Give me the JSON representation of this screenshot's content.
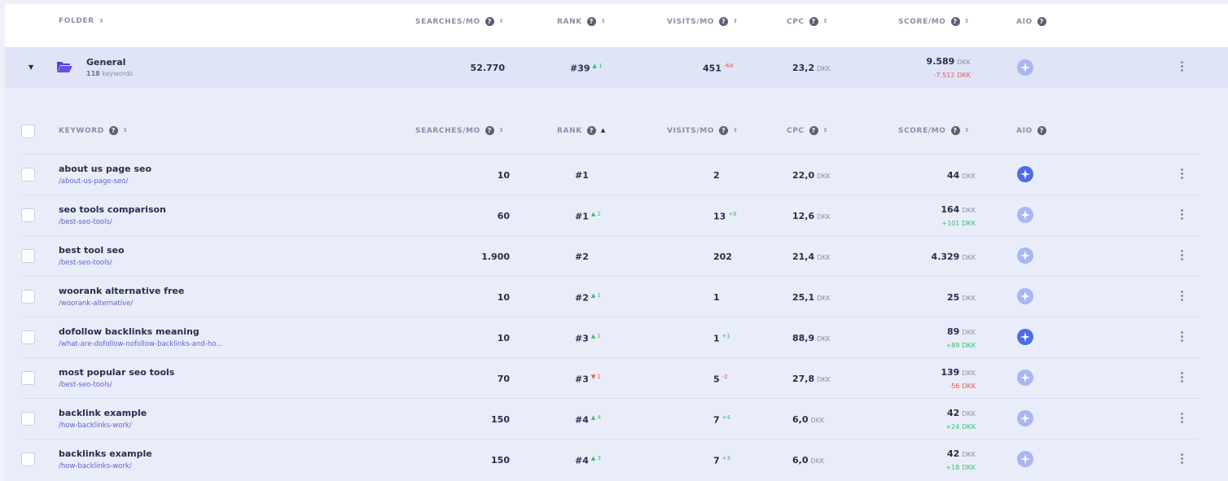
{
  "folder_header": {
    "folder": "FOLDER",
    "searches": "SEARCHES/MO",
    "rank": "RANK",
    "visits": "VISITS/MO",
    "cpc": "CPC",
    "score": "SCORE/MO",
    "aio": "AIO"
  },
  "folder": {
    "name": "General",
    "count": "118",
    "count_label": "keywords",
    "searches": "52.770",
    "rank": "#39",
    "rank_delta": "1",
    "visits": "451",
    "visits_delta": "-64",
    "cpc": "23,2",
    "score": "9.589",
    "score_delta": "-7.512",
    "unit": "DKK"
  },
  "keyword_header": {
    "keyword": "KEYWORD",
    "searches": "SEARCHES/MO",
    "rank": "RANK",
    "visits": "VISITS/MO",
    "cpc": "CPC",
    "score": "SCORE/MO",
    "aio": "AIO"
  },
  "rows": [
    {
      "name": "about us page seo",
      "url": "/about-us-page-seo/",
      "searches": "10",
      "rank": "#1",
      "rank_delta": "",
      "rank_dir": "",
      "visits": "2",
      "visits_delta": "",
      "visits_dir": "",
      "cpc": "22,0",
      "score": "44",
      "score_delta": "",
      "score_dir": "",
      "aio": "on"
    },
    {
      "name": "seo tools comparison",
      "url": "/best-seo-tools/",
      "searches": "60",
      "rank": "#1",
      "rank_delta": "2",
      "rank_dir": "up",
      "visits": "13",
      "visits_delta": "+8",
      "visits_dir": "up",
      "cpc": "12,6",
      "score": "164",
      "score_delta": "+101",
      "score_dir": "up",
      "aio": "off"
    },
    {
      "name": "best tool seo",
      "url": "/best-seo-tools/",
      "searches": "1.900",
      "rank": "#2",
      "rank_delta": "",
      "rank_dir": "",
      "visits": "202",
      "visits_delta": "",
      "visits_dir": "",
      "cpc": "21,4",
      "score": "4.329",
      "score_delta": "",
      "score_dir": "",
      "aio": "off"
    },
    {
      "name": "woorank alternative free",
      "url": "/woorank-alternative/",
      "searches": "10",
      "rank": "#2",
      "rank_delta": "1",
      "rank_dir": "up",
      "visits": "1",
      "visits_delta": "",
      "visits_dir": "",
      "cpc": "25,1",
      "score": "25",
      "score_delta": "",
      "score_dir": "",
      "aio": "off"
    },
    {
      "name": "dofollow backlinks meaning",
      "url": "/what-are-dofollow-nofollow-backlinks-and-ho...",
      "searches": "10",
      "rank": "#3",
      "rank_delta": "1",
      "rank_dir": "up",
      "visits": "1",
      "visits_delta": "+1",
      "visits_dir": "up",
      "cpc": "88,9",
      "score": "89",
      "score_delta": "+89",
      "score_dir": "up",
      "aio": "on"
    },
    {
      "name": "most popular seo tools",
      "url": "/best-seo-tools/",
      "searches": "70",
      "rank": "#3",
      "rank_delta": "1",
      "rank_dir": "down",
      "visits": "5",
      "visits_delta": "-2",
      "visits_dir": "down",
      "cpc": "27,8",
      "score": "139",
      "score_delta": "-56",
      "score_dir": "down",
      "aio": "off"
    },
    {
      "name": "backlink example",
      "url": "/how-backlinks-work/",
      "searches": "150",
      "rank": "#4",
      "rank_delta": "4",
      "rank_dir": "up",
      "visits": "7",
      "visits_delta": "+4",
      "visits_dir": "up",
      "cpc": "6,0",
      "score": "42",
      "score_delta": "+24",
      "score_dir": "up",
      "aio": "off"
    },
    {
      "name": "backlinks example",
      "url": "/how-backlinks-work/",
      "searches": "150",
      "rank": "#4",
      "rank_delta": "3",
      "rank_dir": "up",
      "visits": "7",
      "visits_delta": "+3",
      "visits_dir": "up",
      "cpc": "6,0",
      "score": "42",
      "score_delta": "+18",
      "score_dir": "up",
      "aio": "off"
    }
  ],
  "icons": {
    "folder": "folder-open-icon",
    "aio": "sparkle-icon",
    "menu": "kebab-menu-icon"
  },
  "colors": {
    "accent": "#4f6bea",
    "positive": "#35c16b",
    "negative": "#f05252",
    "folder_icon": "#5a3fd6"
  }
}
